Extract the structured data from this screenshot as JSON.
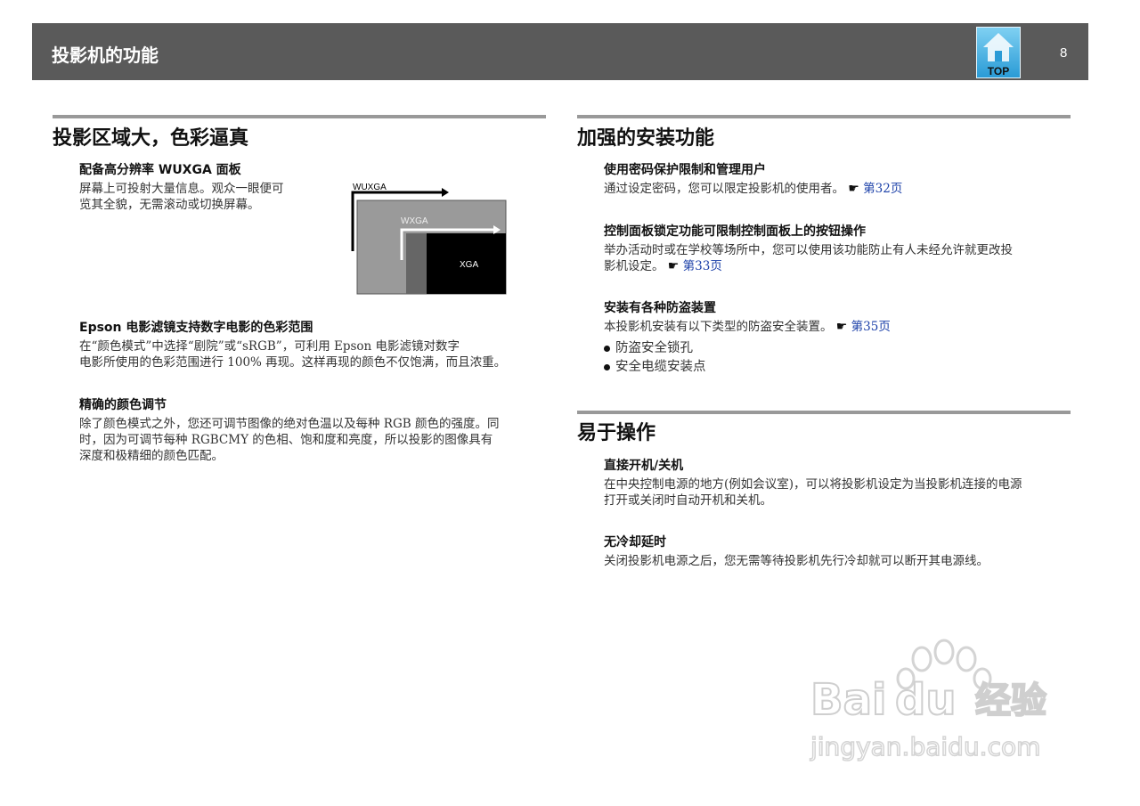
{
  "header": {
    "title": "投影机的功能",
    "top_label": "TOP",
    "page_number": "8"
  },
  "left": {
    "section_title": "投影区域大，色彩逼真",
    "blocks": [
      {
        "heading": "配备高分辨率 WUXGA 面板",
        "lines": [
          "屏幕上可投射大量信息。观众一眼便可",
          "览其全貌，无需滚动或切换屏幕。"
        ]
      },
      {
        "heading": "Epson 电影滤镜支持数字电影的色彩范围",
        "lines": [
          "在“颜色模式”中选择“剧院”或“sRGB”，可利用 Epson 电影滤镜对数字",
          "电影所使用的色彩范围进行 100% 再现。这样再现的颜色不仅饱满，而且浓重。"
        ]
      },
      {
        "heading": "精确的颜色调节",
        "lines": [
          "除了颜色模式之外，您还可调节图像的绝对色温以及每种 RGB 颜色的强度。同",
          "时，因为可调节每种 RGBCMY 的色相、饱和度和亮度，所以投影的图像具有",
          "深度和极精细的颜色匹配。"
        ]
      }
    ],
    "diagram": {
      "labels": [
        "WUXGA",
        "WXGA",
        "XGA"
      ]
    }
  },
  "right": {
    "section1_title": "加强的安装功能",
    "s1_blocks": [
      {
        "heading": "使用密码保护限制和管理用户",
        "lines": [
          "通过设定密码，您可以限定投影机的使用者。"
        ],
        "link": "第32页"
      },
      {
        "heading": "控制面板锁定功能可限制控制面板上的按钮操作",
        "lines": [
          "举办活动时或在学校等场所中，您可以使用该功能防止有人未经允许就更改投",
          "影机设定。"
        ],
        "link": "第33页"
      },
      {
        "heading": "安装有各种防盗装置",
        "lines": [
          "本投影机安装有以下类型的防盗安全装置。"
        ],
        "link": "第35页",
        "bullets": [
          "防盗安全锁孔",
          "安全电缆安装点"
        ]
      }
    ],
    "section2_title": "易于操作",
    "s2_blocks": [
      {
        "heading": "直接开机/关机",
        "lines": [
          "在中央控制电源的地方(例如会议室)，可以将投影机设定为当投影机连接的电源",
          "打开或关闭时自动开机和关机。"
        ]
      },
      {
        "heading": "无冷却延时",
        "lines": [
          "关闭投影机电源之后，您无需等待投影机先行冷却就可以断开其电源线。"
        ]
      }
    ]
  },
  "icons": {
    "reference_pointer": "pointing-hand-icon",
    "top_button": "house-icon"
  },
  "watermark": {
    "brand": "Baidu经验",
    "url": "jingyan.baidu.com"
  },
  "colors": {
    "header_bg": "#5a5a5a",
    "link": "#1a3fa8",
    "section_rule": "#999999"
  }
}
